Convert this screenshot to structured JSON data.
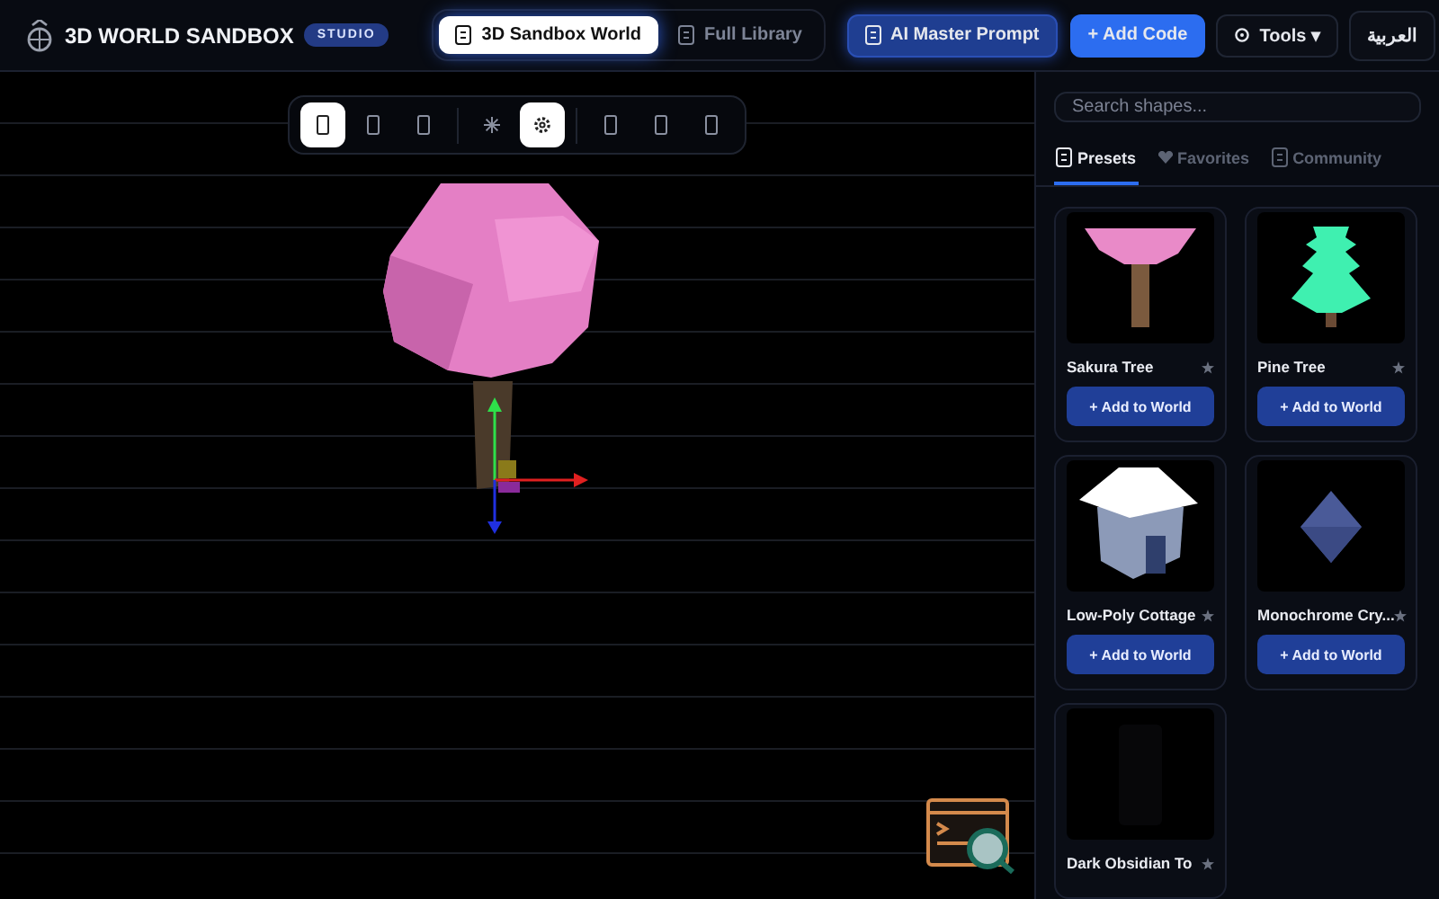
{
  "app": {
    "title": "3D WORLD SANDBOX",
    "badge": "STUDIO"
  },
  "nav_tabs": [
    {
      "label": "3D Sandbox World",
      "selected": true
    },
    {
      "label": "Full Library",
      "selected": false
    }
  ],
  "actions": [
    {
      "kind": "prompt",
      "label": "AI Master Prompt"
    },
    {
      "kind": "primary",
      "label": "+ Add Code"
    },
    {
      "kind": "menu",
      "label": "Tools ▾"
    },
    {
      "kind": "plain",
      "label": "العربية"
    }
  ],
  "toolbar": [
    {
      "kind": "tool",
      "selected": true
    },
    {
      "kind": "tool",
      "selected": false
    },
    {
      "kind": "tool",
      "selected": false
    },
    {
      "kind": "divider"
    },
    {
      "kind": "light",
      "selected": false
    },
    {
      "kind": "settings",
      "selected": true
    },
    {
      "kind": "divider"
    },
    {
      "kind": "tool",
      "selected": false
    },
    {
      "kind": "tool",
      "selected": false
    },
    {
      "kind": "tool",
      "selected": false
    }
  ],
  "search": {
    "placeholder": "Search shapes..."
  },
  "library_tabs": [
    {
      "label": "Presets",
      "kind": "doc",
      "selected": true
    },
    {
      "label": "Favorites",
      "kind": "heart",
      "selected": false
    },
    {
      "label": "Community",
      "kind": "doc",
      "selected": false
    }
  ],
  "shapes": [
    {
      "name": "Sakura Tree",
      "kind": "sakura",
      "favorite": false,
      "button": "+ Add to World"
    },
    {
      "name": "Pine Tree",
      "kind": "pine",
      "favorite": false,
      "button": "+ Add to World"
    },
    {
      "name": "Low-Poly Cottage",
      "kind": "cottage",
      "favorite": false,
      "button": "+ Add to World"
    },
    {
      "name": "Monochrome Cry...",
      "kind": "crystal",
      "favorite": false,
      "button": "+ Add to World"
    },
    {
      "name": "Dark Obsidian To",
      "kind": "obsidian",
      "favorite": false
    }
  ]
}
